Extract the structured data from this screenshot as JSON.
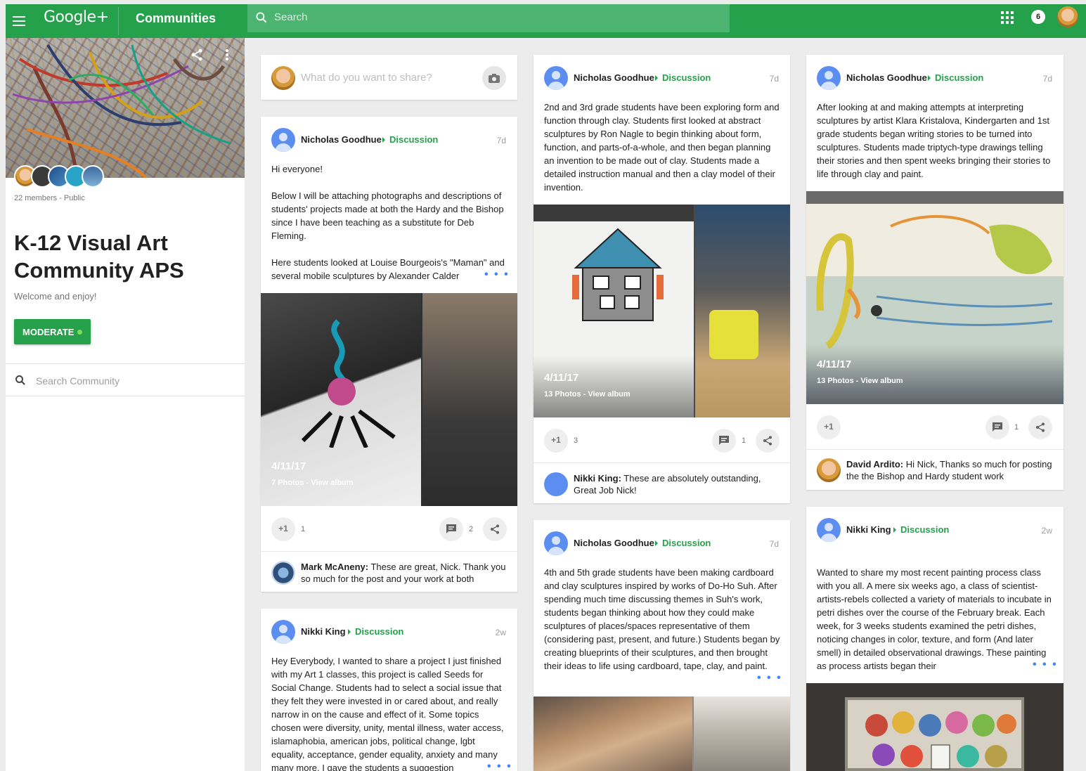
{
  "header": {
    "logo": "Google+",
    "section": "Communities",
    "search_placeholder": "Search",
    "notification_count": "6"
  },
  "community": {
    "members": "22 members - Public",
    "title": "K-12 Visual Art Community APS",
    "tagline": "Welcome and enjoy!",
    "moderate_label": "MODERATE",
    "search_placeholder": "Search Community"
  },
  "compose": {
    "placeholder": "What do you want to share?"
  },
  "posts": [
    {
      "author": "Nicholas Goodhue",
      "category": "Discussion",
      "time": "7d",
      "paragraphs": [
        "Hi everyone!",
        "Below I will be attaching photographs and descriptions of students' projects made at both the Hardy and the Bishop since I have been teaching as a substitute for Deb Fleming.",
        "Here students looked at Louise Bourgeois's \"Maman\" and several mobile sculptures by Alexander Calder"
      ],
      "album_date": "4/11/17",
      "album_link": "7 Photos - View album",
      "plus_label": "+1",
      "plus_count": "1",
      "comment_count": "2",
      "comment_author": "Mark McAneny:",
      "comment_text": "These are great, Nick. Thank you so much for the post and your work at both"
    },
    {
      "author": "Nikki King",
      "category": "Discussion",
      "time": "2w",
      "body": "Hey Everybody, I wanted to share a project I just finished with my Art 1 classes, this project is called Seeds for Social Change. Students had to select a social issue that they felt they were invested in or cared about, and really narrow in on the cause and effect of it. Some topics chosen were diversity, unity, mental illness, water access, islamaphobia, american jobs, political change, lgbt equality, acceptance, gender equality, anxiety and many many more. I gave the students a suggestion"
    },
    {
      "author": "Nicholas Goodhue",
      "category": "Discussion",
      "time": "7d",
      "body": "2nd and 3rd grade students have been exploring form and function through clay. Students first looked at abstract sculptures by Ron Nagle to begin thinking about form, function, and parts-of-a-whole, and then began planning an invention to be made out of clay. Students made a detailed instruction manual and then a clay model of their invention.",
      "album_date": "4/11/17",
      "album_link": "13 Photos - View album",
      "plus_label": "+1",
      "plus_count": "3",
      "comment_count": "1",
      "comment_author": "Nikki King:",
      "comment_text": "These are absolutely outstanding, Great Job Nick!"
    },
    {
      "author": "Nicholas Goodhue",
      "category": "Discussion",
      "time": "7d",
      "body": "4th and 5th grade students have been making cardboard and clay sculptures inspired by works of Do-Ho Suh. After spending much time discussing themes in Suh's work, students began thinking about how they could make sculptures of places/spaces representative of them (considering past, present, and future.) Students began by creating blueprints of their sculptures, and then brought their ideas to life using cardboard, tape, clay, and paint."
    },
    {
      "author": "Nicholas Goodhue",
      "category": "Discussion",
      "time": "7d",
      "body": "After looking at and making attempts at interpreting sculptures by artist Klara Kristalova, Kindergarten and 1st grade students began writing stories to be turned into sculptures. Students made triptych-type drawings telling their stories and then spent weeks bringing their stories to life through clay and paint.",
      "album_date": "4/11/17",
      "album_link": "13 Photos - View album",
      "plus_label": "+1",
      "comment_count": "1",
      "comment_author": "David Ardito:",
      "comment_text": "Hi Nick, Thanks so much for posting the the Bishop and Hardy student work"
    },
    {
      "author": "Nikki King",
      "category": "Discussion",
      "time": "2w",
      "body": "Wanted to share my most recent painting process class with you all. A mere six weeks ago, a class of scientist-artists-rebels collected a variety of materials to incubate in petri dishes over the course of the February break. Each week, for 3 weeks students examined the petri dishes, noticing changes in color, texture, and form (And later smell) in detailed observational drawings. These painting as process artists began their"
    }
  ],
  "colors": {
    "brand_green": "#25a04b",
    "link_blue": "#4285f4"
  },
  "icons": [
    "menu-icon",
    "search-icon",
    "apps-icon",
    "share-icon",
    "more-vert-icon",
    "camera-icon",
    "comment-icon",
    "share-icon"
  ]
}
